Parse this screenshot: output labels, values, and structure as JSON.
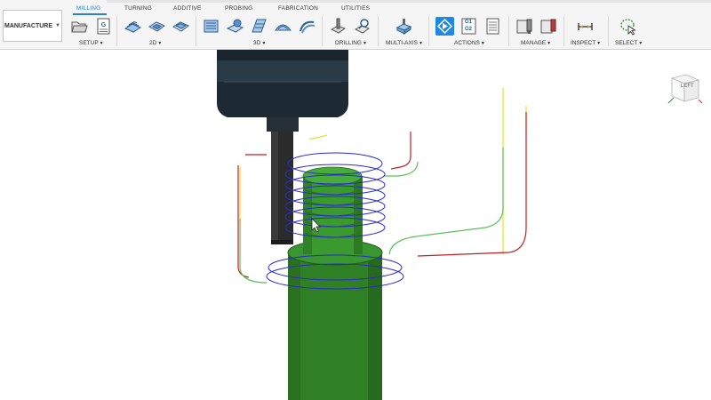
{
  "workspace": {
    "label": "MANUFACTURE"
  },
  "tabs": [
    {
      "label": "MILLING",
      "active": true
    },
    {
      "label": "TURNING",
      "active": false
    },
    {
      "label": "ADDITIVE",
      "active": false
    },
    {
      "label": "PROBING",
      "active": false
    },
    {
      "label": "FABRICATION",
      "active": false
    },
    {
      "label": "UTILITIES",
      "active": false
    }
  ],
  "groups": {
    "setup": "SETUP",
    "two_d": "2D",
    "three_d": "3D",
    "drilling": "DRILLING",
    "multi_axis": "MULTI-AXIS",
    "actions": "ACTIONS",
    "manage": "MANAGE",
    "inspect": "INSPECT",
    "select": "SELECT"
  },
  "tools": {
    "setup_new": "folder-open-icon",
    "setup_nc": "nc-program-icon",
    "twod_adaptive": "2d-adaptive-icon",
    "twod_pocket": "2d-pocket-icon",
    "twod_face": "face-icon",
    "threed_adaptive": "3d-adaptive-icon",
    "threed_pocket": "3d-pocket-icon",
    "threed_steep": "steep-shallow-icon",
    "threed_scallop": "scallop-icon",
    "threed_flow": "flow-icon",
    "drill": "drill-icon",
    "hole_recognition": "hole-recognition-icon",
    "multiaxis": "multi-axis-icon",
    "simulate": "simulate-icon",
    "post_process": "g1g2-post-icon",
    "setup_sheet": "setup-sheet-icon",
    "tool_library": "tool-library-icon",
    "template": "template-icon",
    "measure": "measure-icon",
    "select": "select-lasso-icon"
  },
  "g1g2": {
    "line1": "G1",
    "line2": "G2"
  },
  "viewcube": {
    "face": "LEFT"
  },
  "colors": {
    "accent": "#1e88e5",
    "part_green": "#3a8f2c",
    "toolpath_blue": "#2a2ad0",
    "toolpath_red": "#c02020",
    "toolpath_yellow": "#e8e030",
    "toolpath_green": "#5cc05c",
    "tool_holder": "#1f2c36"
  }
}
